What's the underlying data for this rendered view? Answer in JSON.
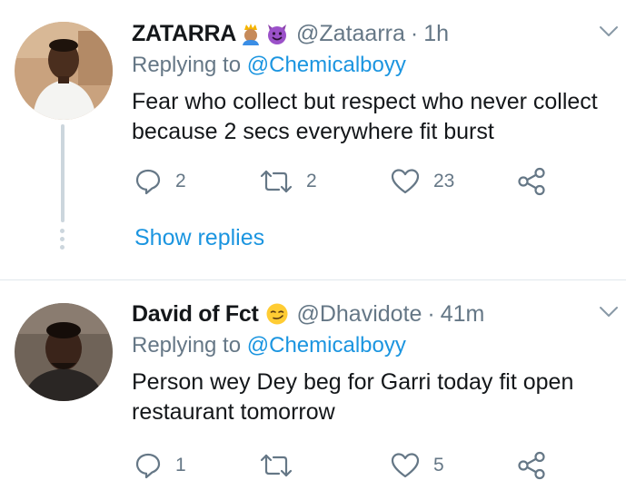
{
  "tweets": [
    {
      "name": "ZATARRA",
      "emojis": [
        "prince-emoji",
        "smiling-devil-emoji"
      ],
      "handle": "@Zataarra",
      "separator": "·",
      "time": "1h",
      "replying_prefix": "Replying to",
      "replying_to": "@Chemicalboyy",
      "text": "Fear who collect but respect who never collect because 2 secs everywhere fit burst",
      "replies": "2",
      "retweets": "2",
      "likes": "23",
      "show_replies": "Show replies"
    },
    {
      "name": "David of Fct",
      "emojis": [
        "smirking-face-emoji"
      ],
      "handle": "@Dhavidote",
      "separator": "·",
      "time": "41m",
      "replying_prefix": "Replying to",
      "replying_to": "@Chemicalboyy",
      "text": "Person wey Dey beg for Garri today fit open restaurant tomorrow",
      "replies": "1",
      "retweets": "",
      "likes": "5"
    }
  ],
  "colors": {
    "link": "#1b95e0",
    "muted": "#657786",
    "text": "#14171a",
    "divider": "#e1e8ed",
    "thread": "#ccd6dd"
  }
}
